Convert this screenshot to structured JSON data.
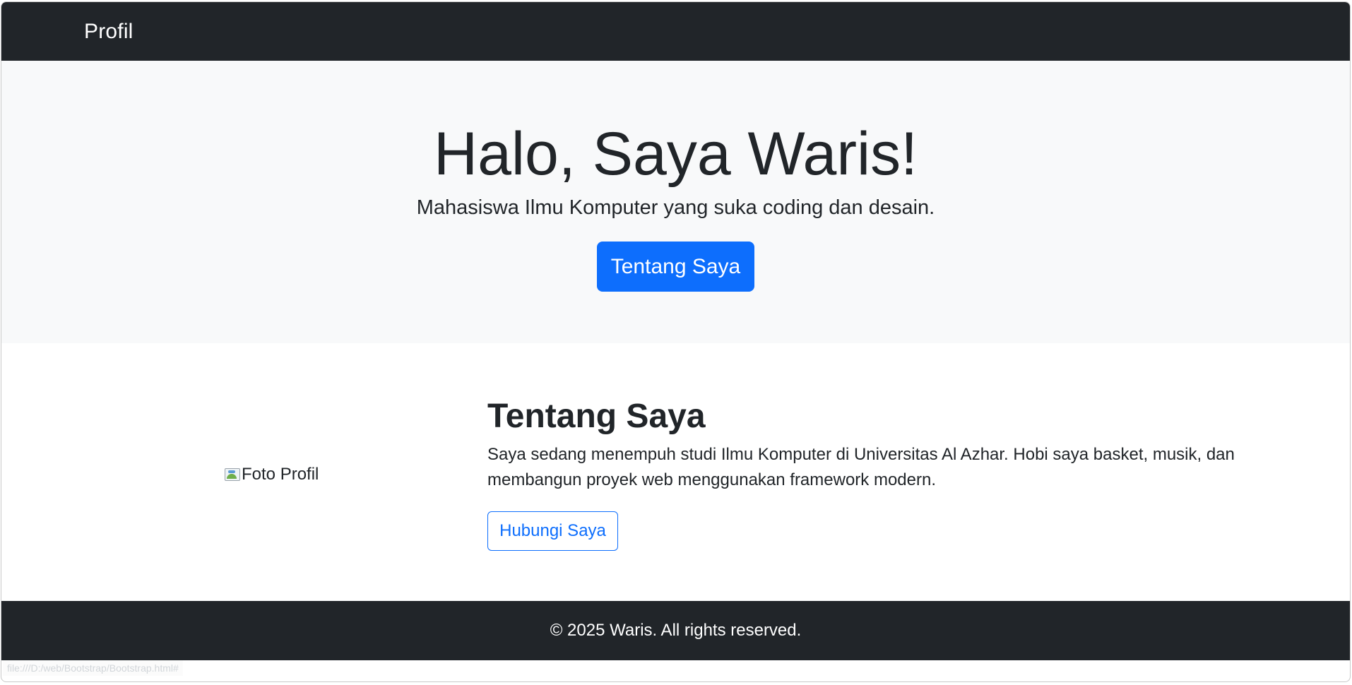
{
  "navbar": {
    "brand": "Profil"
  },
  "hero": {
    "title": "Halo, Saya Waris!",
    "subtitle": "Mahasiswa Ilmu Komputer yang suka coding dan desain.",
    "button_label": "Tentang Saya"
  },
  "about": {
    "photo_alt": "Foto Profil",
    "heading": "Tentang Saya",
    "description": "Saya sedang menempuh studi Ilmu Komputer di Universitas Al Azhar. Hobi saya basket, musik, dan membangun proyek web menggunakan framework modern.",
    "contact_button": "Hubungi Saya"
  },
  "footer": {
    "text": "© 2025 Waris. All rights reserved."
  },
  "status_bar": {
    "url": "file:///D:/web/Bootstrap/Bootstrap.html#"
  },
  "colors": {
    "dark": "#212529",
    "light_bg": "#f8f9fa",
    "primary": "#0d6efd"
  }
}
